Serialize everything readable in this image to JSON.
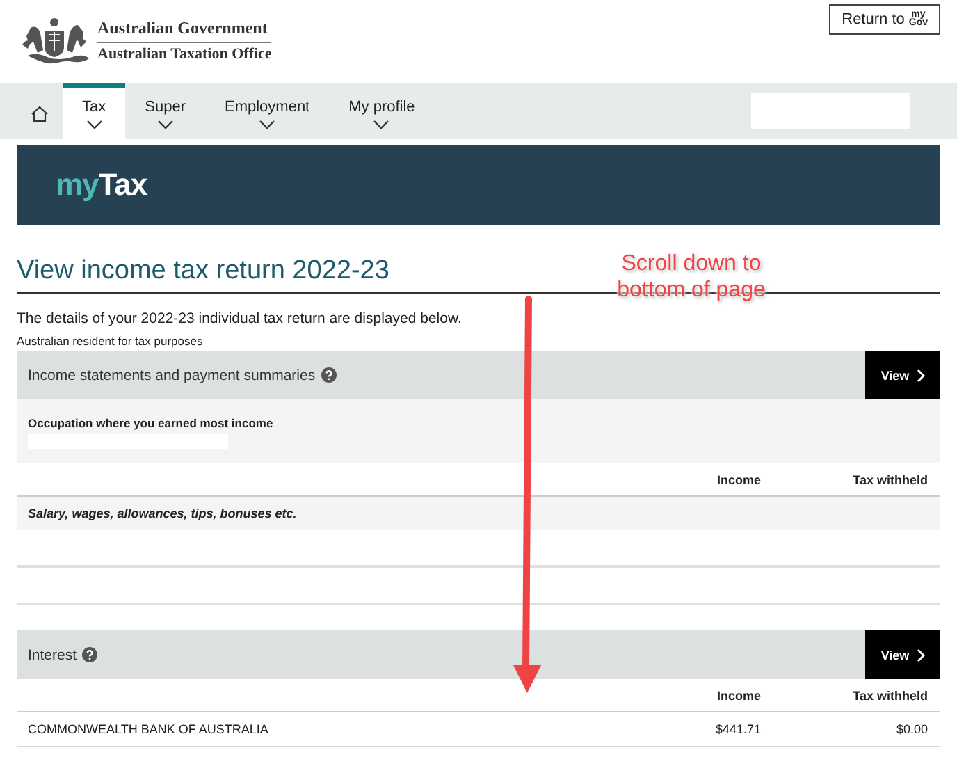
{
  "header": {
    "agency_lines": [
      "Australian Government",
      "Australian Taxation Office"
    ],
    "return_button": {
      "label": "Return to",
      "logo_top": "my",
      "logo_bottom": "Gov"
    }
  },
  "nav": {
    "tabs": [
      {
        "kind": "home",
        "selected": false
      },
      {
        "kind": "menu",
        "label": "Tax",
        "selected": true
      },
      {
        "kind": "menu",
        "label": "Super",
        "selected": false
      },
      {
        "kind": "menu",
        "label": "Employment",
        "selected": false
      },
      {
        "kind": "menu",
        "label": "My profile",
        "selected": false
      }
    ]
  },
  "banner": {
    "brand_first": "my",
    "brand_second": "Tax"
  },
  "page": {
    "title": "View income tax return 2022-23",
    "intro": "The details of your 2022-23 individual tax return are displayed below.",
    "residency": "Australian resident for tax purposes"
  },
  "sections": [
    {
      "title": "Income statements and payment summaries",
      "button": "View",
      "occupation_label": "Occupation where you earned most income",
      "columns": [
        "Income",
        "Tax withheld"
      ],
      "rows": [
        {
          "kind": "group",
          "label": "Salary, wages, allowances, tips, bonuses etc."
        },
        {
          "kind": "blank"
        },
        {
          "kind": "blank"
        }
      ]
    },
    {
      "title": "Interest",
      "button": "View",
      "columns": [
        "Income",
        "Tax withheld"
      ],
      "rows": [
        {
          "kind": "item",
          "label": "COMMONWEALTH BANK OF AUSTRALIA",
          "income": "$441.71",
          "tax": "$0.00"
        }
      ]
    }
  ],
  "annotation": {
    "text": "Scroll down to bottom of page"
  }
}
